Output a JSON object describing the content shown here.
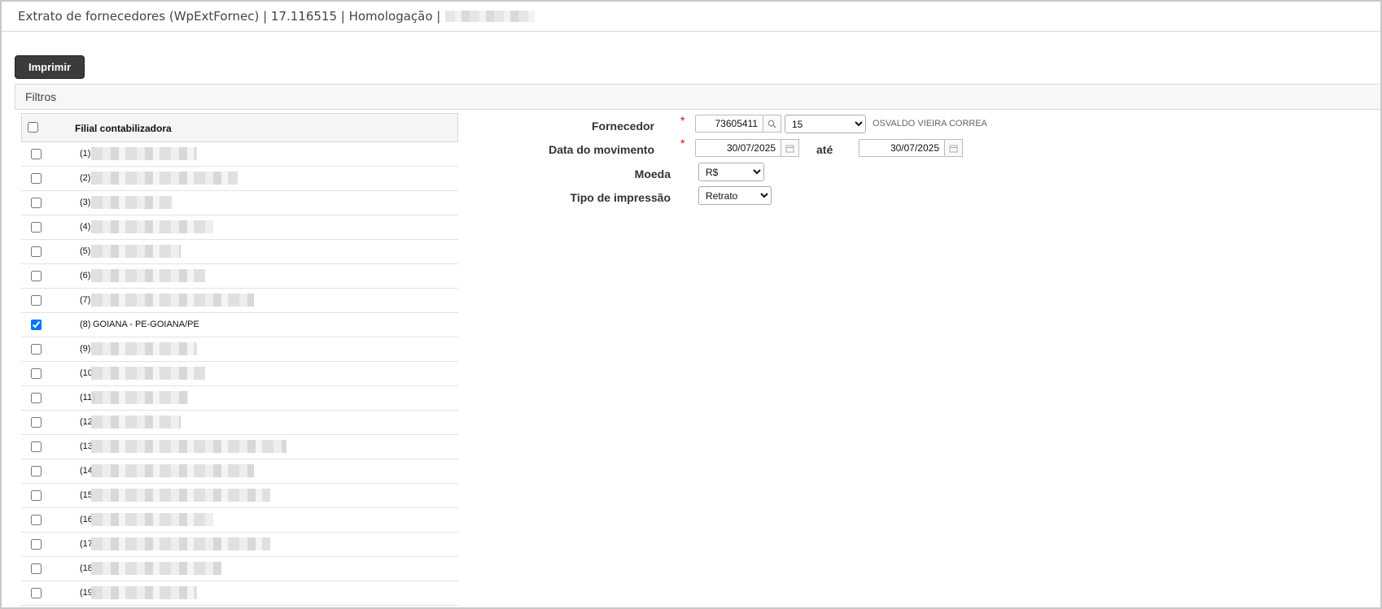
{
  "window": {
    "title": "Extrato de fornecedores (WpExtFornec) | 17.116515 | Homologação |"
  },
  "toolbar": {
    "print_label": "Imprimir"
  },
  "filters": {
    "section_title": "Filtros",
    "branch_table": {
      "header": "Filial contabilizadora",
      "rows": [
        {
          "code": "(1)",
          "name": "",
          "checked": false
        },
        {
          "code": "(2)",
          "name": "",
          "checked": false
        },
        {
          "code": "(3)",
          "name": "",
          "checked": false
        },
        {
          "code": "(4)",
          "name": "",
          "checked": false
        },
        {
          "code": "(5)",
          "name": "",
          "checked": false
        },
        {
          "code": "(6)",
          "name": "",
          "checked": false
        },
        {
          "code": "(7)",
          "name": "",
          "checked": false
        },
        {
          "code": "(8)",
          "name": "GOIANA - PE-GOIANA/PE",
          "checked": true
        },
        {
          "code": "(9)",
          "name": "",
          "checked": false
        },
        {
          "code": "(10",
          "name": "",
          "checked": false
        },
        {
          "code": "(11)",
          "name": "",
          "checked": false
        },
        {
          "code": "(12",
          "name": "",
          "checked": false
        },
        {
          "code": "(13",
          "name": "",
          "checked": false
        },
        {
          "code": "(14",
          "name": "",
          "checked": false
        },
        {
          "code": "(15",
          "name": "",
          "checked": false
        },
        {
          "code": "(16",
          "name": "",
          "checked": false
        },
        {
          "code": "(17",
          "name": "",
          "checked": false
        },
        {
          "code": "(18",
          "name": "",
          "checked": false
        },
        {
          "code": "(19)",
          "name": "",
          "checked": false
        }
      ]
    },
    "form": {
      "supplier_label": "Fornecedor",
      "supplier_code": "73605411",
      "supplier_branch": "15",
      "supplier_name": "OSVALDO VIEIRA CORREA",
      "date_label": "Data do movimento",
      "date_from": "30/07/2025",
      "until_label": "até",
      "date_to": "30/07/2025",
      "currency_label": "Moeda",
      "currency": "R$",
      "print_type_label": "Tipo de impressão",
      "print_type": "Retrato",
      "required_mark": "*"
    }
  }
}
